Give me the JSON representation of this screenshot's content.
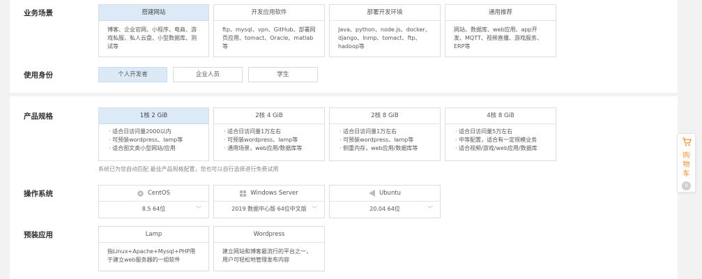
{
  "business": {
    "label": "业务场景",
    "cards": [
      {
        "title": "搭建网站",
        "desc": "博客、企业官网、小程序、电商、游戏私服、私人云盘、小型数据库、测试等"
      },
      {
        "title": "开发应用软件",
        "desc": "ftp、mysql、vpn、GitHub、部署网页应用、tomact、Oracle、matlab等"
      },
      {
        "title": "部署开发环境",
        "desc": "Java、python、node.js、docker、django、lnmp、tomact、ftp、hadoop等"
      },
      {
        "title": "通用推荐",
        "desc": "网站、数据库、web应用、app开发、MQTT、视频直播、游戏服务、ERP等"
      }
    ]
  },
  "identity": {
    "label": "使用身份",
    "options": [
      "个人开发者",
      "企业人员",
      "学生"
    ]
  },
  "spec": {
    "label": "产品规格",
    "cards": [
      {
        "title": "1核 2 GiB",
        "lines": [
          "适合日访问量2000以内",
          "可预装wordpress、lamp等",
          "适合图文类小型网站/应用"
        ]
      },
      {
        "title": "2核 4 GiB",
        "lines": [
          "适合日访问量1万左右",
          "可预装wordpress、lamp等",
          "通用场景，web应用/数据库等"
        ]
      },
      {
        "title": "2核 8 GiB",
        "lines": [
          "适合日访问量1万左右",
          "可预装wordpress、lamp等",
          "侧重内存，web应用/数据库等"
        ]
      },
      {
        "title": "4核 8 GiB",
        "lines": [
          "适合日访问量5万左右",
          "中等配置，适合有一定规模业务",
          "适合视频/游戏/web应用/数据库"
        ]
      }
    ],
    "note": "系统已为您自动匹配 最佳产品规格配置，您也可以自行选择进行免费试用"
  },
  "os": {
    "label": "操作系统",
    "cards": [
      {
        "name": "CentOS",
        "icon": "centos-icon",
        "version": "8.5 64位"
      },
      {
        "name": "Windows Server",
        "icon": "windows-icon",
        "version": "2019 数据中心版 64位中文版"
      },
      {
        "name": "Ubuntu",
        "icon": "ubuntu-icon",
        "version": "20.04 64位"
      }
    ]
  },
  "apps": {
    "label": "预装应用",
    "cards": [
      {
        "title": "Lamp",
        "desc": "指Linux+Apache+Mysql+PHP用于建立web服务器的一组软件"
      },
      {
        "title": "Wordpress",
        "desc": "建立网站和博客最流行的平台之一，用户可轻松地管理发布内容"
      }
    ]
  },
  "cart": {
    "label": "购物车",
    "chars": [
      "购",
      "物",
      "车"
    ],
    "count": "0"
  },
  "colors": {
    "selected": "#dbeaf6",
    "accent": "#f08c2c"
  }
}
